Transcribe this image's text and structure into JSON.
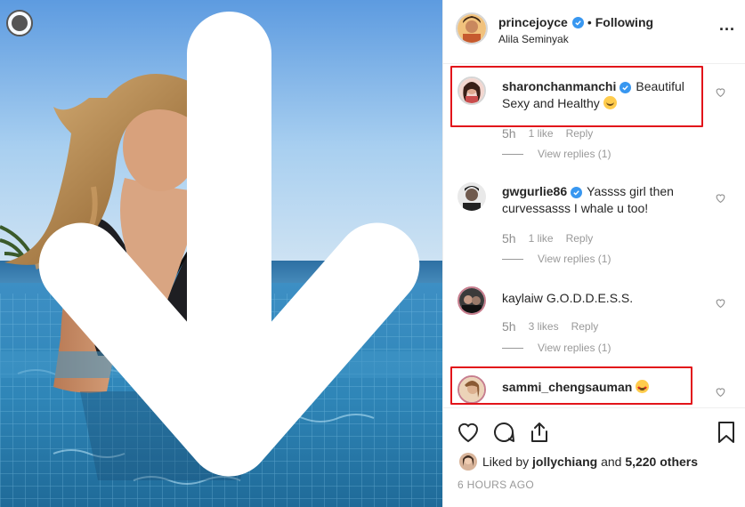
{
  "photo": {
    "download_icon": "arrow-down-circle-icon"
  },
  "header": {
    "username": "princejoyce",
    "separator": "•",
    "follow_status": "Following",
    "location": "Alila Seminyak",
    "more_icon": "more-horizontal-icon",
    "more_label": "..."
  },
  "comments": [
    {
      "username": "sharonchanmanchi",
      "verified": true,
      "text": "Beautiful Sexy and Healthy",
      "emoji": "blush-kiss-emoji",
      "age": "5h",
      "likes": "1 like",
      "reply": "Reply",
      "view_replies": "View replies (1)"
    },
    {
      "username": "gwgurlie86",
      "verified": true,
      "text": "Yassss girl then curvessasss I whale u too!",
      "age": "5h",
      "likes": "1 like",
      "reply": "Reply",
      "view_replies": "View replies (1)"
    },
    {
      "username": "kaylaiw",
      "verified": false,
      "text": "G.O.D.D.E.S.S.",
      "age": "5h",
      "likes": "3 likes",
      "reply": "Reply",
      "view_replies": "View replies (1)"
    },
    {
      "username": "sammi_chengsauman",
      "verified": false,
      "text": "",
      "emoji": "star-struck-emoji"
    }
  ],
  "actions": {
    "like_icon": "heart-icon",
    "comment_icon": "comment-icon",
    "share_icon": "share-icon",
    "save_icon": "bookmark-icon",
    "liked_by_prefix": "Liked by",
    "liked_by_user": "jollychiang",
    "liked_by_mid": "and",
    "liked_by_count": "5,220 others",
    "time_ago": "6 HOURS AGO"
  },
  "colors": {
    "highlight_box": "#e2141a",
    "verified_badge": "#3897f0",
    "secondary_text": "#999999"
  }
}
